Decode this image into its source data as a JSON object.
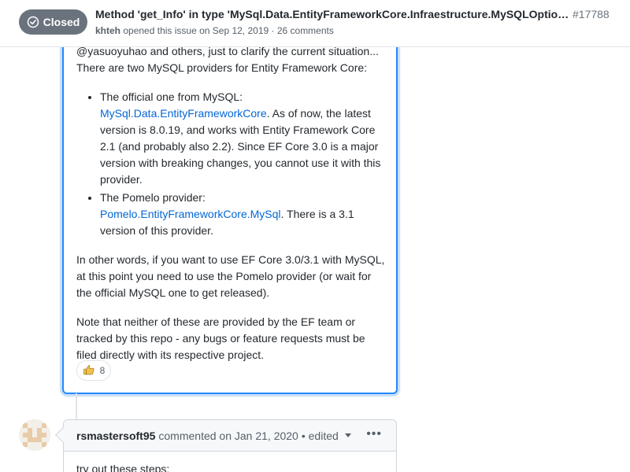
{
  "header": {
    "state_label": "Closed",
    "title": "Method 'get_Info' in type 'MySql.Data.EntityFrameworkCore.Infraestructure.MySQLOptionsE...",
    "number": "#17788",
    "author": "khteh",
    "meta_text": "opened this issue on Sep 12, 2019 · 26 comments"
  },
  "comment1": {
    "para1_line1": "@yasuoyuhao and others, just to clarify the current situation...",
    "para1_line2": "There are two MySQL providers for Entity Framework Core:",
    "bullet1_intro": "The official one from MySQL:",
    "bullet1_link": "MySql.Data.EntityFrameworkCore",
    "bullet1_text": ". As of now, the latest version is 8.0.19, and works with Entity Framework Core 2.1 (and probably also 2.2). Since EF Core 3.0 is a major version with breaking changes, you cannot use it with this provider.",
    "bullet2_intro": "The Pomelo provider: ",
    "bullet2_link": "Pomelo.EntityFrameworkCore.MySql",
    "bullet2_text": ". There is a 3.1 version of this provider.",
    "para2": "In other words, if you want to use EF Core 3.0/3.1 with MySQL, at this point you need to use the Pomelo provider (or wait for the official MySQL one to get released).",
    "para3": "Note that neither of these are provided by the EF team or tracked by this repo - any bugs or feature requests must be filed directly with its respective project.",
    "reaction_icon": "thumbs-up",
    "reaction_count": "8"
  },
  "comment2": {
    "author": "rsmastersoft95",
    "meta": "commented on Jan 21, 2020",
    "edited": "• edited",
    "body": "try out these steps:"
  },
  "colors": {
    "link": "#0366d6",
    "closed_badge": "#6a737d",
    "highlight_border": "#2188ff"
  }
}
